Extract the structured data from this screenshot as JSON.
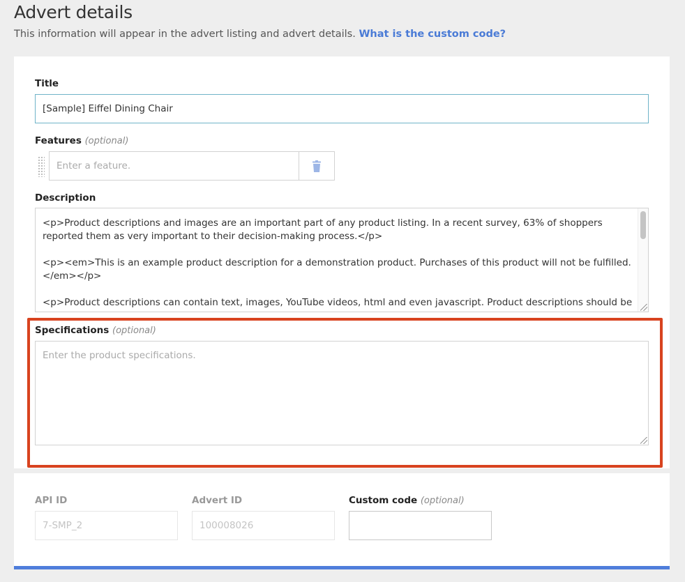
{
  "header": {
    "title": "Advert details",
    "subtitle": "This information will appear in the advert listing and advert details.",
    "help_link": "What is the custom code?"
  },
  "form": {
    "title_label": "Title",
    "title_value": "[Sample] Eiffel Dining Chair",
    "features_label": "Features",
    "features_optional": "(optional)",
    "feature_placeholder": "Enter a feature.",
    "description_label": "Description",
    "description_paragraphs": [
      "<p>Product descriptions and images are an important part of any product listing. In a recent survey, 63% of shoppers reported them as very important to their decision-making process.</p>",
      "<p><em>This is an example product description for a demonstration product. Purchases of this product will not be fulfilled.</em></p>",
      "<p>Product descriptions can contain text, images, YouTube videos, html and even javascript. Product descriptions should be less"
    ],
    "specifications_label": "Specifications",
    "specifications_optional": "(optional)",
    "specifications_placeholder": "Enter the product specifications."
  },
  "ids": {
    "api_id_label": "API ID",
    "api_id_value": "7-SMP_2",
    "advert_id_label": "Advert ID",
    "advert_id_value": "100008026",
    "custom_code_label": "Custom code",
    "custom_code_optional": "(optional)",
    "custom_code_value": ""
  },
  "colors": {
    "link": "#4a7bd6",
    "highlight": "#d8431f",
    "accent_bar": "#4f7edb"
  },
  "icons": {
    "delete": "trash-icon",
    "drag": "drag-handle-icon"
  }
}
